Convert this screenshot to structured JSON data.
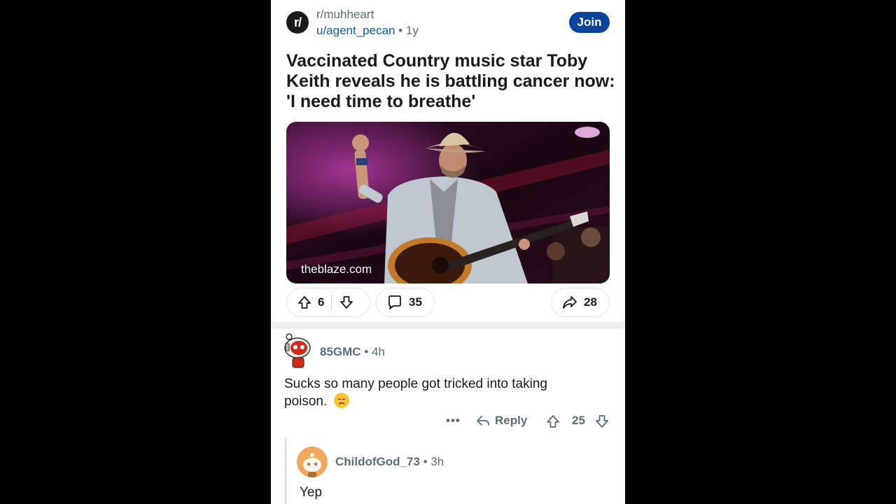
{
  "post": {
    "subreddit_icon_text": "r/",
    "subreddit": "r/muhheart",
    "author": "u/agent_pecan",
    "separator": "•",
    "age": "1y",
    "join_label": "Join",
    "title": "Vaccinated Country music star Toby Keith reveals he is battling cancer now: 'I need time to breathe'",
    "link_domain": "theblaze.com",
    "upvotes": "6",
    "comments": "35",
    "shares": "28"
  },
  "comments": [
    {
      "author": "85GMC",
      "age": "4h",
      "body": "Sucks so many people got tricked into taking poison.",
      "emoji": "disappointed-face",
      "more_label": "•••",
      "reply_label": "Reply",
      "score": "25"
    },
    {
      "author": "ChildofGod_73",
      "age": "3h",
      "body": "Yep"
    }
  ],
  "colors": {
    "join_button": "#0a449b",
    "username_link": "#0a5aa6",
    "meta_text": "#576f76",
    "title_text": "#1a1a1b"
  }
}
